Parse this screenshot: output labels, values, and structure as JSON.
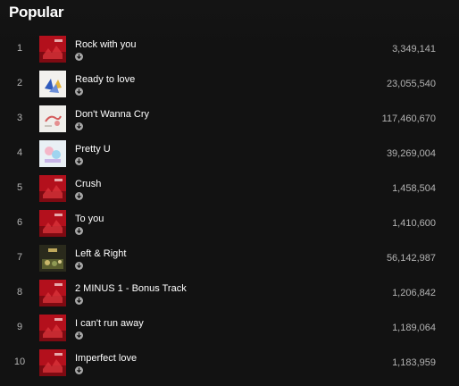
{
  "section": {
    "title": "Popular"
  },
  "tracks": [
    {
      "index": "1",
      "name": "Rock with you",
      "plays": "3,349,141",
      "art": "red-album"
    },
    {
      "index": "2",
      "name": "Ready to love",
      "plays": "23,055,540",
      "art": "blue-white-album"
    },
    {
      "index": "3",
      "name": "Don't Wanna Cry",
      "plays": "117,460,670",
      "art": "pale-album"
    },
    {
      "index": "4",
      "name": "Pretty U",
      "plays": "39,269,004",
      "art": "pastel-album"
    },
    {
      "index": "5",
      "name": "Crush",
      "plays": "1,458,504",
      "art": "red-album"
    },
    {
      "index": "6",
      "name": "To you",
      "plays": "1,410,600",
      "art": "red-album"
    },
    {
      "index": "7",
      "name": "Left & Right",
      "plays": "56,142,987",
      "art": "dark-olive-album"
    },
    {
      "index": "8",
      "name": "2 MINUS 1 - Bonus Track",
      "plays": "1,206,842",
      "art": "red-album"
    },
    {
      "index": "9",
      "name": "I can't run away",
      "plays": "1,189,064",
      "art": "red-album"
    },
    {
      "index": "10",
      "name": "Imperfect love",
      "plays": "1,183,959",
      "art": "red-album"
    }
  ],
  "colors": {
    "background": "#121212",
    "text_primary": "#ffffff",
    "text_secondary": "#b3b3b3",
    "download_icon": "#a7a7a7"
  },
  "icons": {
    "download": "download-arrow-circle-icon"
  }
}
